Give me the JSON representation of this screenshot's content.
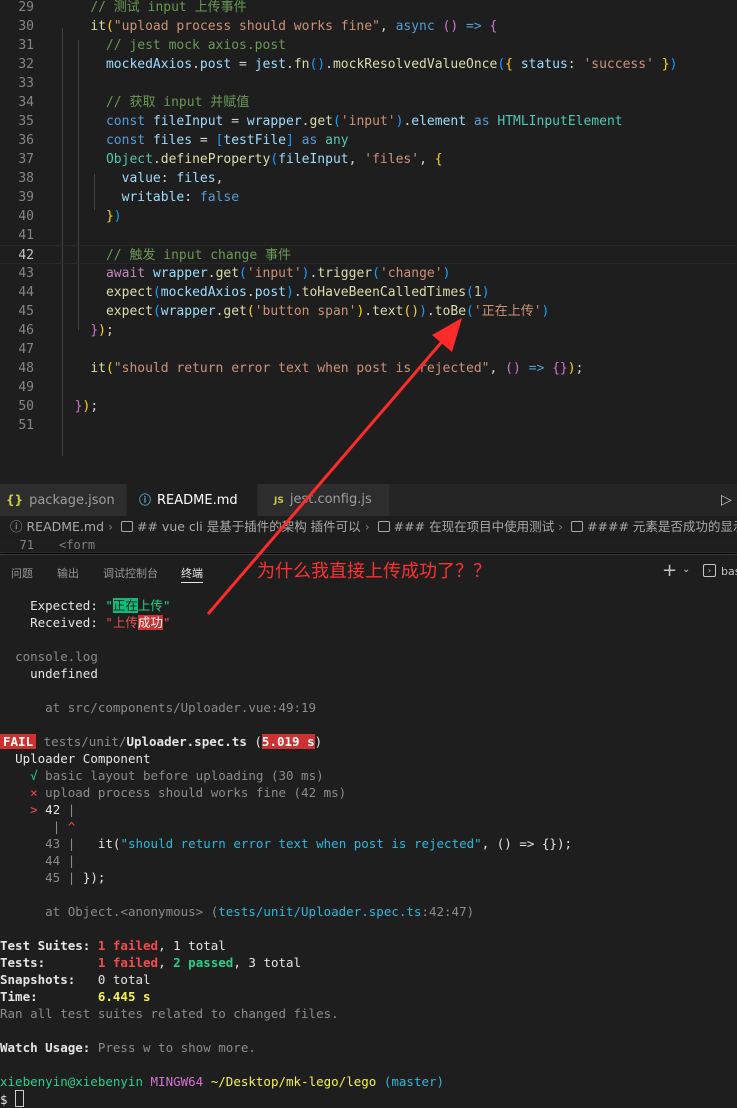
{
  "editor": {
    "lines": [
      {
        "num": "29",
        "tokens": [
          [
            "    ",
            "p"
          ],
          [
            "// 测试 input 上传事件",
            "c"
          ]
        ]
      },
      {
        "num": "30",
        "tokens": [
          [
            "    ",
            "p"
          ],
          [
            "it",
            "f"
          ],
          [
            "(",
            "b1"
          ],
          [
            "\"upload process should works fine\"",
            "s"
          ],
          [
            ", ",
            "p"
          ],
          [
            "async",
            "k"
          ],
          [
            " ",
            "p"
          ],
          [
            "()",
            "b2"
          ],
          [
            " ",
            "p"
          ],
          [
            "=>",
            "k"
          ],
          [
            " ",
            "p"
          ],
          [
            "{",
            "b2"
          ]
        ]
      },
      {
        "num": "31",
        "tokens": [
          [
            "      ",
            "p"
          ],
          [
            "// jest mock axios.post",
            "c"
          ]
        ]
      },
      {
        "num": "32",
        "tokens": [
          [
            "      ",
            "p"
          ],
          [
            "mockedAxios",
            "v"
          ],
          [
            ".",
            "p"
          ],
          [
            "post",
            "v"
          ],
          [
            " = ",
            "p"
          ],
          [
            "jest",
            "v"
          ],
          [
            ".",
            "p"
          ],
          [
            "fn",
            "f"
          ],
          [
            "()",
            "b3"
          ],
          [
            ".",
            "p"
          ],
          [
            "mockResolvedValueOnce",
            "f"
          ],
          [
            "(",
            "b3"
          ],
          [
            "{ ",
            "b1"
          ],
          [
            "status",
            "v"
          ],
          [
            ": ",
            "p"
          ],
          [
            "'success'",
            "s"
          ],
          [
            " }",
            "b1"
          ],
          [
            ")",
            "b3"
          ]
        ]
      },
      {
        "num": "33",
        "tokens": []
      },
      {
        "num": "34",
        "tokens": [
          [
            "      ",
            "p"
          ],
          [
            "// 获取 input 并赋值",
            "c"
          ]
        ]
      },
      {
        "num": "35",
        "tokens": [
          [
            "      ",
            "p"
          ],
          [
            "const",
            "k"
          ],
          [
            " ",
            "p"
          ],
          [
            "fileInput",
            "v"
          ],
          [
            " = ",
            "p"
          ],
          [
            "wrapper",
            "v"
          ],
          [
            ".",
            "p"
          ],
          [
            "get",
            "f"
          ],
          [
            "(",
            "b3"
          ],
          [
            "'input'",
            "s"
          ],
          [
            ")",
            "b3"
          ],
          [
            ".",
            "p"
          ],
          [
            "element",
            "v"
          ],
          [
            " ",
            "p"
          ],
          [
            "as",
            "k"
          ],
          [
            " ",
            "p"
          ],
          [
            "HTMLInputElement",
            "t"
          ]
        ]
      },
      {
        "num": "36",
        "tokens": [
          [
            "      ",
            "p"
          ],
          [
            "const",
            "k"
          ],
          [
            " ",
            "p"
          ],
          [
            "files",
            "v"
          ],
          [
            " = ",
            "p"
          ],
          [
            "[",
            "b3"
          ],
          [
            "testFile",
            "v"
          ],
          [
            "]",
            "b3"
          ],
          [
            " ",
            "p"
          ],
          [
            "as",
            "k"
          ],
          [
            " ",
            "p"
          ],
          [
            "any",
            "t"
          ]
        ]
      },
      {
        "num": "37",
        "tokens": [
          [
            "      ",
            "p"
          ],
          [
            "Object",
            "t"
          ],
          [
            ".",
            "p"
          ],
          [
            "defineProperty",
            "f"
          ],
          [
            "(",
            "b3"
          ],
          [
            "fileInput",
            "v"
          ],
          [
            ", ",
            "p"
          ],
          [
            "'files'",
            "s"
          ],
          [
            ", ",
            "p"
          ],
          [
            "{",
            "b1"
          ]
        ]
      },
      {
        "num": "38",
        "tokens": [
          [
            "        ",
            "p"
          ],
          [
            "value",
            "v"
          ],
          [
            ": ",
            "p"
          ],
          [
            "files",
            "v"
          ],
          [
            ",",
            "p"
          ]
        ]
      },
      {
        "num": "39",
        "tokens": [
          [
            "        ",
            "p"
          ],
          [
            "writable",
            "v"
          ],
          [
            ": ",
            "p"
          ],
          [
            "false",
            "k"
          ]
        ]
      },
      {
        "num": "40",
        "tokens": [
          [
            "      ",
            "p"
          ],
          [
            "}",
            "b1"
          ],
          [
            ")",
            "b3"
          ]
        ]
      },
      {
        "num": "41",
        "tokens": []
      },
      {
        "num": "42",
        "tokens": [
          [
            "      ",
            "p"
          ],
          [
            "// 触发 input change 事件",
            "c"
          ]
        ],
        "active": true
      },
      {
        "num": "43",
        "tokens": [
          [
            "      ",
            "p"
          ],
          [
            "await",
            "kw"
          ],
          [
            " ",
            "p"
          ],
          [
            "wrapper",
            "v"
          ],
          [
            ".",
            "p"
          ],
          [
            "get",
            "f"
          ],
          [
            "(",
            "b3"
          ],
          [
            "'input'",
            "s"
          ],
          [
            ")",
            "b3"
          ],
          [
            ".",
            "p"
          ],
          [
            "trigger",
            "f"
          ],
          [
            "(",
            "b3"
          ],
          [
            "'change'",
            "s"
          ],
          [
            ")",
            "b3"
          ]
        ]
      },
      {
        "num": "44",
        "tokens": [
          [
            "      ",
            "p"
          ],
          [
            "expect",
            "f"
          ],
          [
            "(",
            "b3"
          ],
          [
            "mockedAxios",
            "v"
          ],
          [
            ".",
            "p"
          ],
          [
            "post",
            "v"
          ],
          [
            ")",
            "b3"
          ],
          [
            ".",
            "p"
          ],
          [
            "toHaveBeenCalledTimes",
            "f"
          ],
          [
            "(",
            "b3"
          ],
          [
            "1",
            "n"
          ],
          [
            ")",
            "b3"
          ]
        ]
      },
      {
        "num": "45",
        "tokens": [
          [
            "      ",
            "p"
          ],
          [
            "expect",
            "f"
          ],
          [
            "(",
            "b3"
          ],
          [
            "wrapper",
            "v"
          ],
          [
            ".",
            "p"
          ],
          [
            "get",
            "f"
          ],
          [
            "(",
            "b1"
          ],
          [
            "'button span'",
            "s"
          ],
          [
            ")",
            "b1"
          ],
          [
            ".",
            "p"
          ],
          [
            "text",
            "f"
          ],
          [
            "()",
            "b1"
          ],
          [
            ")",
            "b3"
          ],
          [
            ".",
            "p"
          ],
          [
            "toBe",
            "f"
          ],
          [
            "(",
            "b3"
          ],
          [
            "'正在上传'",
            "s"
          ],
          [
            ")",
            "b3"
          ]
        ]
      },
      {
        "num": "46",
        "tokens": [
          [
            "    ",
            "p"
          ],
          [
            "}",
            "b2"
          ],
          [
            ")",
            "b1"
          ],
          [
            ";",
            "p"
          ]
        ]
      },
      {
        "num": "47",
        "tokens": []
      },
      {
        "num": "48",
        "tokens": [
          [
            "    ",
            "p"
          ],
          [
            "it",
            "f"
          ],
          [
            "(",
            "b1"
          ],
          [
            "\"should return error text when post is rejected\"",
            "s"
          ],
          [
            ", ",
            "p"
          ],
          [
            "()",
            "b2"
          ],
          [
            " ",
            "p"
          ],
          [
            "=>",
            "k"
          ],
          [
            " ",
            "p"
          ],
          [
            "{}",
            "b2"
          ],
          [
            ")",
            "b1"
          ],
          [
            ";",
            "p"
          ]
        ]
      },
      {
        "num": "49",
        "tokens": []
      },
      {
        "num": "50",
        "tokens": [
          [
            "  ",
            "p"
          ],
          [
            "}",
            "b2"
          ],
          [
            ")",
            "b1"
          ],
          [
            ";",
            "p"
          ]
        ]
      },
      {
        "num": "51",
        "tokens": []
      }
    ]
  },
  "tabs": [
    {
      "icon": "{}",
      "label": "package.json",
      "active": false,
      "icon_color": "#cbcb41"
    },
    {
      "icon": "ⓘ",
      "label": "README.md",
      "active": true,
      "icon_color": "#519aba"
    },
    {
      "icon": "JS",
      "label": "jest.config.js",
      "active": false,
      "icon_color": "#cbcb41"
    }
  ],
  "breadcrumb": [
    "README.md",
    "## vue cli 是基于插件的架构 插件可以",
    "### 在现在项目中使用测试",
    "#### 元素是否成功的显示"
  ],
  "sticky": {
    "num": "71",
    "text": "<form"
  },
  "panel": {
    "tabs": [
      "问题",
      "输出",
      "调试控制台",
      "终端"
    ],
    "active_tab": "终端",
    "add_label": "+",
    "terminal_label": "bas",
    "annotation": "为什么我直接上传成功了？？"
  },
  "terminal": {
    "expected_label": "Expected: ",
    "expected_hl": "正在",
    "expected_rest": "上传",
    "received_label": "Received: ",
    "received_plain": "上传",
    "received_hl": "成功",
    "console_log": "console.log",
    "undefined": "undefined",
    "at_uploader": "at src/components/Uploader.vue:49:19",
    "fail": "FAIL",
    "spec_dir": "tests/unit/",
    "spec_file": "Uploader.spec.ts",
    "spec_time": "5.019 s",
    "suite_name": "Uploader Component",
    "pass_mark": "√",
    "pass_test": "basic layout before uploading (30 ms)",
    "fail_mark": "×",
    "fail_test": "upload process should works fine (42 ms)",
    "code_42": "42",
    "code_43": "43",
    "code_43_it": "it",
    "code_43_str": "\"should return error text when post is rejected\"",
    "code_43_rest": ", () => {});",
    "code_44": "44",
    "code_45": "45",
    "code_45_text": "});",
    "at_object": "at Object.<anonymous> (",
    "at_object_path": "tests/unit/Uploader.spec.ts",
    "at_object_loc": ":42:47)",
    "suites_label": "Test Suites: ",
    "suites_failed": "1 failed",
    "suites_total": ", 1 total",
    "tests_label": "Tests:       ",
    "tests_failed": "1 failed",
    "tests_passed": "2 passed",
    "tests_total": ", 3 total",
    "snap_label": "Snapshots:   ",
    "snap_val": "0 total",
    "time_label": "Time:        ",
    "time_val": "6.445 s",
    "ran_all": "Ran all test suites related to changed files.",
    "watch_label": "Watch Usage: ",
    "watch_text": "Press w to show more.",
    "prompt_user": "xiebenyin@xiebenyin",
    "prompt_host": "MINGW64",
    "prompt_path": "~/Desktop/mk-lego/lego",
    "prompt_branch": "(master)",
    "prompt_symbol": "$"
  },
  "colors": {
    "annotation": "#ff2a2a",
    "fail": "#cd3131",
    "pass": "#23d18b"
  }
}
